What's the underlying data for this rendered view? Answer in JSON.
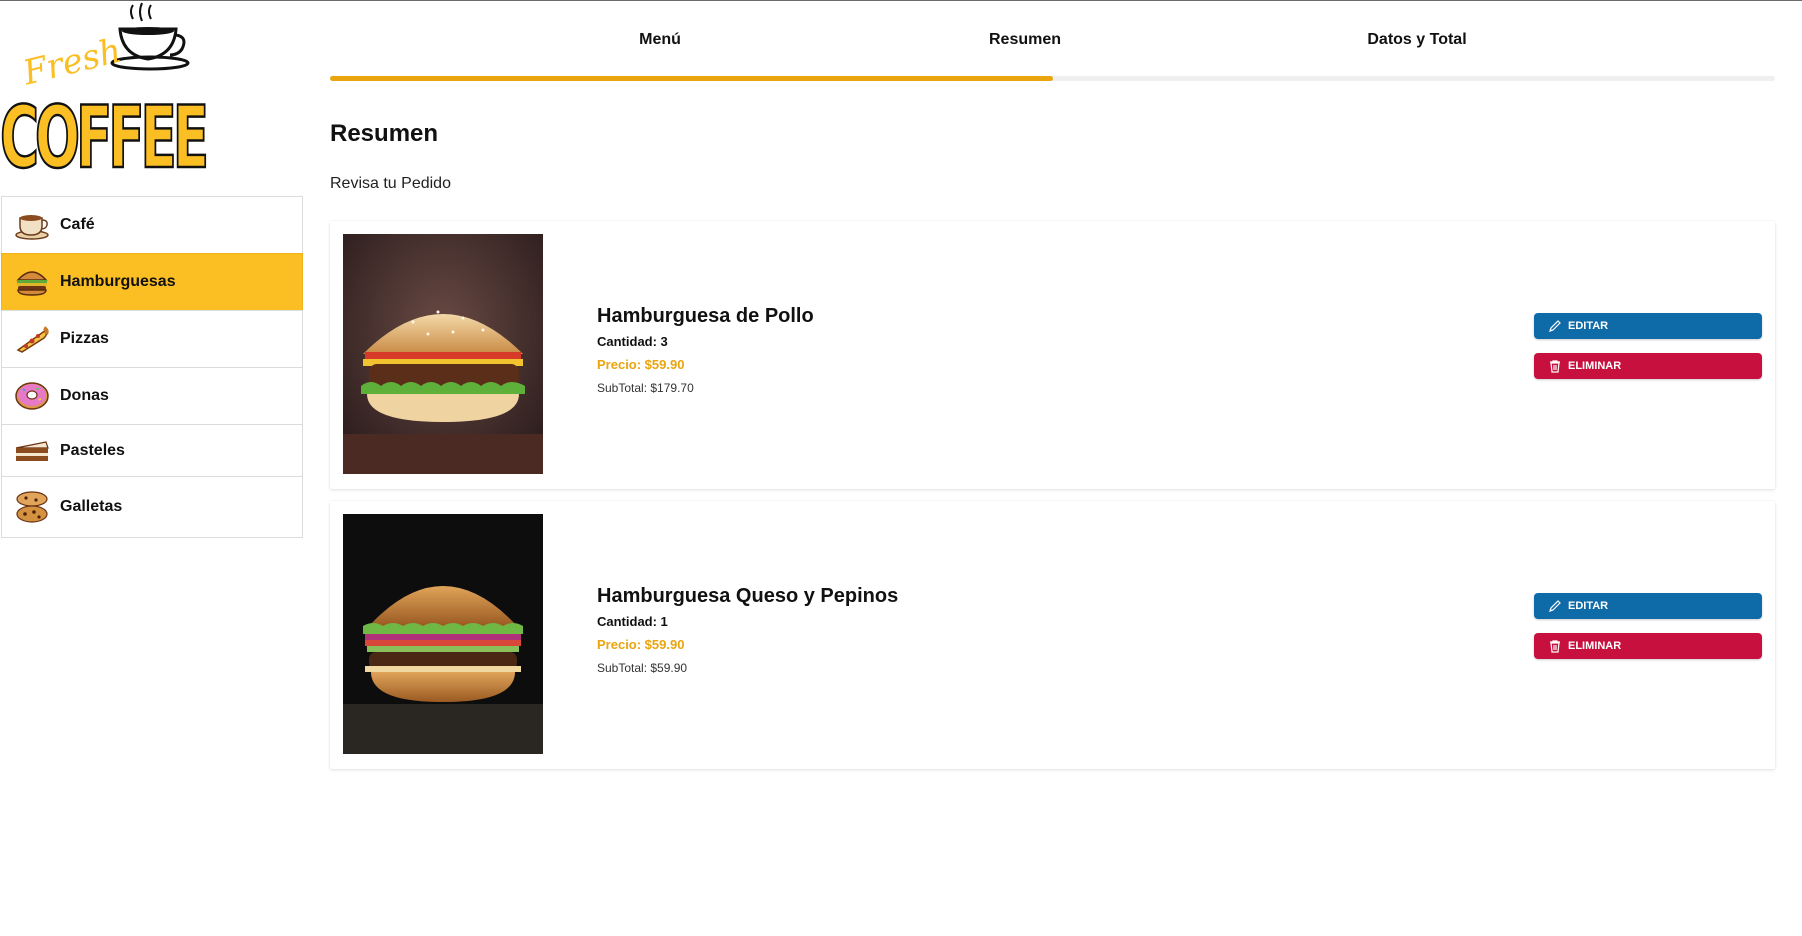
{
  "brand": {
    "logo_top": "Fresh",
    "logo_bottom": "COFFEE"
  },
  "colors": {
    "accent": "#fbbf24",
    "progress": "#e9a40e",
    "edit": "#0e6ba8",
    "delete": "#c8103f",
    "price": "#e9a40e"
  },
  "sidebar": {
    "items": [
      {
        "label": "Café",
        "icon": "coffee-cup-icon",
        "active": false
      },
      {
        "label": "Hamburguesas",
        "icon": "burger-icon",
        "active": true
      },
      {
        "label": "Pizzas",
        "icon": "pizza-slice-icon",
        "active": false
      },
      {
        "label": "Donas",
        "icon": "donut-icon",
        "active": false
      },
      {
        "label": "Pasteles",
        "icon": "cake-slice-icon",
        "active": false
      },
      {
        "label": "Galletas",
        "icon": "cookies-icon",
        "active": false
      }
    ]
  },
  "steps": {
    "items": [
      "Menú",
      "Resumen",
      "Datos y Total"
    ],
    "progress_percent": 50
  },
  "summary": {
    "title": "Resumen",
    "subtitle": "Revisa tu Pedido"
  },
  "order": {
    "items": [
      {
        "name": "Hamburguesa de Pollo",
        "quantity": "Cantidad: 3",
        "price": "Precio: $59.90",
        "subtotal": "SubTotal: $179.70",
        "edit_label": "Editar",
        "delete_label": "Eliminar"
      },
      {
        "name": "Hamburguesa Queso y Pepinos",
        "quantity": "Cantidad: 1",
        "price": "Precio: $59.90",
        "subtotal": "SubTotal: $59.90",
        "edit_label": "Editar",
        "delete_label": "Eliminar"
      }
    ]
  }
}
